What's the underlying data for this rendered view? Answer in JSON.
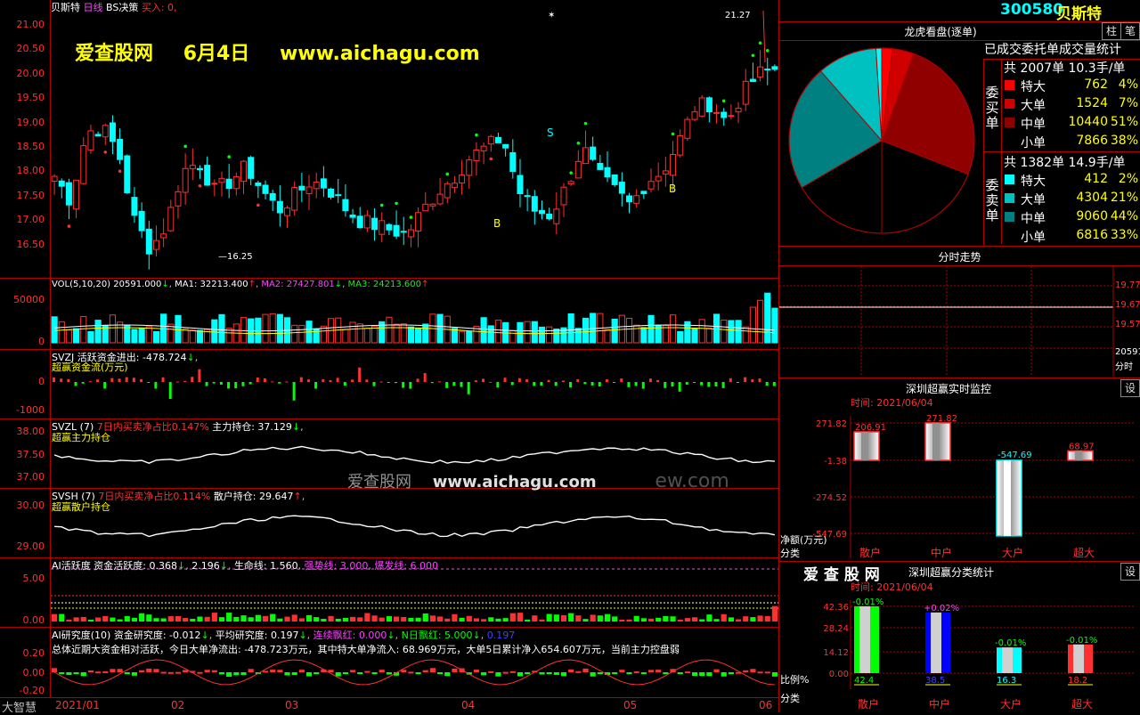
{
  "header": {
    "stock_name": "贝斯特",
    "period": "日线",
    "strategy": "BS决策",
    "buy_signal": "买入: 0,"
  },
  "watermark": {
    "site": "爱查股网",
    "date": "6月4日",
    "url": "www.aichagu.com",
    "center_site": "爱查股网",
    "center_url": "www.aichagu.com",
    "center_tail": "ew.com"
  },
  "price_axis": [
    "21.00",
    "20.50",
    "20.00",
    "19.50",
    "19.00",
    "18.50",
    "18.00",
    "17.50",
    "17.00",
    "16.50"
  ],
  "price_marks": {
    "high": "21.27",
    "low": "16.25",
    "s": "S",
    "b": "B"
  },
  "vol": {
    "title": "VOL(5,10,20)",
    "val": "20591.000",
    "ma1": "MA1: 32213.400",
    "ma2": "MA2: 27427.801",
    "ma3": "MA3: 24213.600",
    "axis": [
      "50000",
      "0"
    ]
  },
  "svzj": {
    "name": "SVZJ",
    "desc": "活跃资金进出: -478.724",
    "sub": "超赢资金流(万元)",
    "axis": [
      "0",
      "-1000"
    ]
  },
  "svzl": {
    "name": "SVZL",
    "n": "(7)",
    "ratio": "7日内买卖净占比0.147%",
    "hold": "主力持仓: 37.129",
    "sub": "超赢主力持仓",
    "axis": [
      "38.00",
      "37.50",
      "37.00"
    ]
  },
  "svsh": {
    "name": "SVSH",
    "n": "(7)",
    "ratio": "7日内买卖净占比0.114%",
    "hold": "散户持仓: 29.647",
    "sub": "超赢散户持仓",
    "axis": [
      "30.00",
      "29.00"
    ]
  },
  "ai_active": {
    "label": "AI活跃度",
    "fund": "资金活跃度: 0.368",
    "v2": "2.196",
    "life": "生命线: 1.560",
    "strong": "强势线: 3.000",
    "burst": "爆发线: 6.000",
    "axis": [
      "5.00",
      "0.00"
    ]
  },
  "ai_research": {
    "label": "AI研究度(10)",
    "fund": "资金研究度: -0.012",
    "avg": "平均研究度: 0.197",
    "cont": "连续飘红: 0.000",
    "nday": "N日飘红: 5.000",
    "extra": "0.197",
    "summary": "总体近期大资金相对活跃，今日大单净流出: -478.723万元，其中特大单净流入: 68.969万元，大单5日累计净入654.607万元，当前主力控盘弱",
    "axis": [
      "0.20",
      "0.00",
      "-0.20"
    ]
  },
  "time_axis": [
    "2021/01",
    "02",
    "03",
    "04",
    "05",
    "06"
  ],
  "brand": "大智慧",
  "right": {
    "code": "300580",
    "name": "贝斯特",
    "btn1": "柱",
    "btn2": "笔",
    "dragon_title": "龙虎看盘(逐单)",
    "stats_title": "已成交委托单成交量统计",
    "buy_total": "共 2007单 10.3手/单",
    "buy_side": "委买单",
    "sell_total": "共 1382单 14.9手/单",
    "sell_side": "委卖单",
    "buy_rows": [
      {
        "name": "特大",
        "val": "762",
        "pct": "4%",
        "color": "#ff0000"
      },
      {
        "name": "大单",
        "val": "1524",
        "pct": "7%",
        "color": "#d00000"
      },
      {
        "name": "中单",
        "val": "10440",
        "pct": "51%",
        "color": "#900000"
      },
      {
        "name": "小单",
        "val": "7866",
        "pct": "38%",
        "color": "#000000"
      }
    ],
    "sell_rows": [
      {
        "name": "特大",
        "val": "412",
        "pct": "2%",
        "color": "#00ffff"
      },
      {
        "name": "大单",
        "val": "4304",
        "pct": "21%",
        "color": "#00c0c0"
      },
      {
        "name": "中单",
        "val": "9060",
        "pct": "44%",
        "color": "#008080"
      },
      {
        "name": "小单",
        "val": "6816",
        "pct": "33%",
        "color": "#000000"
      }
    ],
    "intraday_title": "分时走势",
    "intraday_axis": [
      "19.77",
      "19.67",
      "19.57",
      "20591",
      "分时"
    ],
    "monitor_title": "深圳超赢实时监控",
    "monitor_btn": "设",
    "monitor_time": "时间: 2021/06/04",
    "monitor_axis": [
      "271.82",
      "-1.38",
      "-274.52",
      "-547.69"
    ],
    "monitor_vals": [
      "206.91",
      "271.82",
      "-547.69",
      "68.97"
    ],
    "monitor_ylabel": "净额(万元)",
    "monitor_xlabel": "分类",
    "cats": [
      "散户",
      "中户",
      "大户",
      "超大"
    ],
    "classify_brand": "爱 查 股 网",
    "classify_title": "深圳超赢分类统计",
    "classify_btn": "设",
    "classify_time": "时间: 2021/06/04",
    "classify_axis": [
      "42.36",
      "28.24",
      "14.12",
      "0.00"
    ],
    "classify_pct": [
      "-0.01%",
      "+0.02%",
      "-0.01%",
      "-0.01%"
    ],
    "classify_vals": [
      "42.4",
      "38.5",
      "16.3",
      "18.2"
    ],
    "classify_ylabel": "比例%",
    "classify_xlabel": "分类"
  }
}
